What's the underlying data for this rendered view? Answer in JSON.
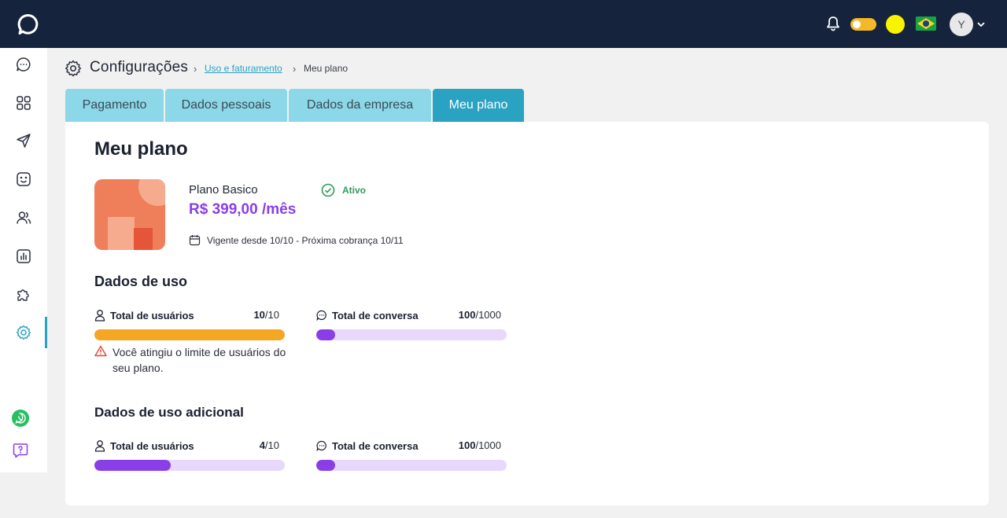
{
  "header": {
    "logo_icon": "chat-bubble-logo",
    "notification_icon": "bell-icon",
    "theme_toggle": "on",
    "avatar_initial": "Y",
    "language_flag": "brazil-flag",
    "colors": {
      "topbar": "#15243c",
      "accent": "#2aa3c2"
    }
  },
  "sidebar": {
    "items": [
      {
        "icon": "chat-icon"
      },
      {
        "icon": "grid-icon"
      },
      {
        "icon": "send-icon"
      },
      {
        "icon": "bot-icon"
      },
      {
        "icon": "users-icon"
      },
      {
        "icon": "reports-icon"
      },
      {
        "icon": "integrations-icon"
      },
      {
        "icon": "gear-icon",
        "active": true
      }
    ],
    "bottom": [
      {
        "icon": "whatsapp-icon"
      },
      {
        "icon": "help-icon"
      }
    ]
  },
  "breadcrumb": {
    "title": "Configurações",
    "link": "Uso e faturamento",
    "current": "Meu plano"
  },
  "tabs": [
    {
      "label": "Pagamento"
    },
    {
      "label": "Dados pessoais"
    },
    {
      "label": "Dados da empresa"
    },
    {
      "label": "Meu plano",
      "active": true
    }
  ],
  "plan": {
    "heading": "Meu plano",
    "name": "Plano Basico",
    "status": "Ativo",
    "price": "R$ 399,00 /mês",
    "validity": "Vigente desde 10/10 - Próxima cobrança 10/11"
  },
  "usage": {
    "heading": "Dados de uso",
    "users": {
      "label": "Total de usuários",
      "used": "10",
      "limit": "/10",
      "fraction": 1.0,
      "color": "#f5a623"
    },
    "conversations": {
      "label": "Total de conversa",
      "used": "100",
      "limit": "/1000",
      "fraction": 0.1,
      "color": "#8a3ee8"
    },
    "warning": "Você atingiu o limite de usuários do seu plano."
  },
  "additional_usage": {
    "heading": "Dados de uso adicional",
    "users": {
      "label": "Total de usuários",
      "used": "4",
      "limit": "/10",
      "fraction": 0.4,
      "color": "#8a3ee8"
    },
    "conversations": {
      "label": "Total de conversa",
      "used": "100",
      "limit": "/1000",
      "fraction": 0.1,
      "color": "#8a3ee8"
    }
  }
}
